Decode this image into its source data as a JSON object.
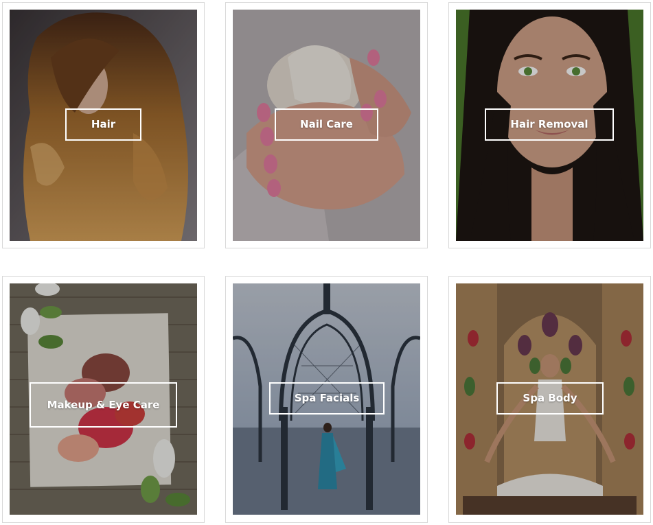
{
  "services": [
    {
      "label": "Hair",
      "image": "woman-with-wavy-blonde-hair"
    },
    {
      "label": "Nail Care",
      "image": "hands-holding-seashell-pink-nails"
    },
    {
      "label": "Hair Removal",
      "image": "woman-face-green-eyes"
    },
    {
      "label": "Makeup & Eye Care",
      "image": "crushed-makeup-on-cloth-with-flowers"
    },
    {
      "label": "Spa Facials",
      "image": "woman-under-iron-gazebo-by-lake"
    },
    {
      "label": "Spa Body",
      "image": "woman-meditating-in-ornate-room"
    }
  ],
  "colors": {
    "border": "#d8d8d8",
    "label": "#ffffff"
  }
}
